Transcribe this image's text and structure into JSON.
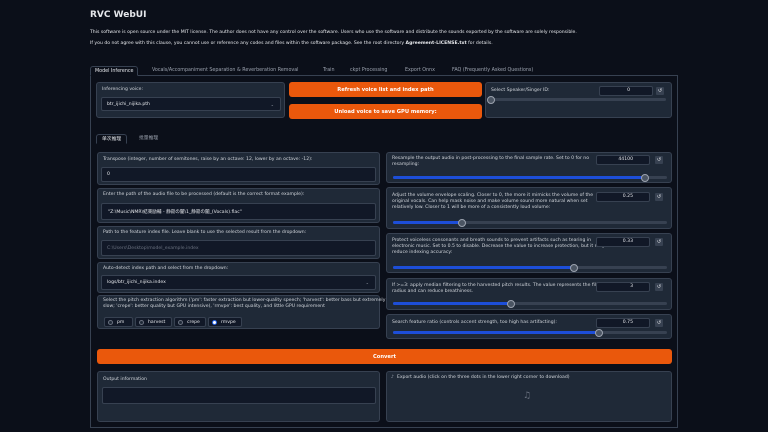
{
  "app": {
    "title": "RVC WebUI",
    "license_line1": "This software is open source under the MIT license. The author does not have any control over the software. Users who use the software and distribute the sounds exported by the software are solely responsible.",
    "license_line2_pre": "If you do not agree with this clause, you cannot use or reference any codes and files within the software package. See the root directory ",
    "license_line2_bold": "Agreement-LICENSE.txt",
    "license_line2_post": " for details."
  },
  "tabs": [
    "Model Inference",
    "Vocals/Accompaniment Separation & Reverberation Removal",
    "Train",
    "ckpt Processing",
    "Export Onnx",
    "FAQ (Frequently Asked Questions)"
  ],
  "model": {
    "label": "Inferencing voice:",
    "value": "btr_ijichi_nijika.pth"
  },
  "buttons": {
    "refresh": "Refresh voice list and index path",
    "unload": "Unload voice to save GPU memory:",
    "convert": "Convert"
  },
  "speaker": {
    "label": "Select Speaker/Singer ID:",
    "value": "0",
    "fraction": 0.0
  },
  "subtabs": [
    "单次推理",
    "批量推理"
  ],
  "transpose": {
    "label": "Transpose (integer, number of semitones, raise by an octave: 12, lower by an octave: -12):",
    "value": "0"
  },
  "audio_path": {
    "label": "Enter the path of the audio file to be processed (default is the correct format example):",
    "value": "\"Z:\\Music\\NMR\\結束励輔 - 静寂の闇\\1_静寂の闇_(Vocals).flac\""
  },
  "feature_path": {
    "label": "Path to the feature index file. Leave blank to use the selected result from the dropdown:",
    "placeholder": "C:\\Users\\Desktop\\model_example.index"
  },
  "auto_index": {
    "label": "Auto-detect index path and select from the dropdown:",
    "value": "logs/btr_ijichi_nijika.index"
  },
  "pitch": {
    "label_line1": "Select the pitch extraction algorithm ('pm': faster extraction but lower-quality speech; 'harvest': better bass but extremely",
    "label_line2": "slow; 'crepe': better quality but GPU intensive), 'rmvpe': best quality, and little GPU requirement",
    "options": [
      "pm",
      "harvest",
      "crepe",
      "rmvpe"
    ],
    "selected": "rmvpe"
  },
  "resample": {
    "label_line1": "Resample the output audio in post-processing to the final sample rate. Set to 0 for no",
    "label_line2": "resampling:",
    "value": "44100",
    "fraction": 0.92
  },
  "envelope": {
    "label_line1": "Adjust the volume envelope scaling. Closer to 0, the more it mimicks the volume of the",
    "label_line2": "original vocals. Can help mask noise and make volume sound more natural when set",
    "label_line3": "relatively low. Closer to 1 will be more of a consistently loud volume:",
    "value": "0.25",
    "fraction": 0.25
  },
  "protect": {
    "label_line1": "Protect voiceless consonants and breath sounds to prevent artifacts such as tearing in",
    "label_line2": "electronic music. Set to 0.5 to disable. Decrease the value to increase protection, but it may",
    "label_line3": "reduce indexing accuracy:",
    "value": "0.33",
    "fraction": 0.66
  },
  "median": {
    "label_line1": "If >=3: apply median filtering to the harvested pitch results. The value represents the filter",
    "label_line2": "radius and can reduce breathiness.",
    "value": "3",
    "fraction": 0.43
  },
  "search": {
    "label": "Search feature ratio (controls accent strength, too high has artifacting):",
    "value": "0.75",
    "fraction": 0.75
  },
  "output": {
    "label": "Output information"
  },
  "export": {
    "label": "Export audio (click on the three dots in the lower right corner to download)"
  }
}
